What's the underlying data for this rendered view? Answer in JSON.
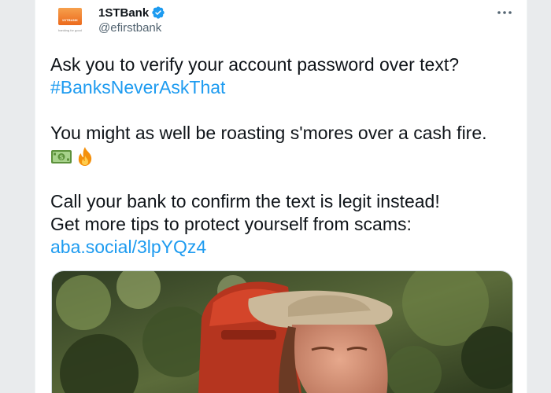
{
  "tweet": {
    "display_name": "1STBank",
    "handle": "@efirstbank",
    "more_icon": "more-horizontal-icon",
    "verified_icon": "verified-badge-icon",
    "avatar": {
      "logo_text": "1STBANK",
      "tagline": "banking for good"
    },
    "body": {
      "line1": "Ask you to verify your account password over text?",
      "hashtag": "#BanksNeverAskThat",
      "line2": "You might as well be roasting s'mores over a cash fire.",
      "emojis": [
        "dollar-banknote-icon",
        "fire-icon"
      ],
      "line3": "Call your bank to confirm the text is legit instead!",
      "line4": "Get more tips to protect yourself from scams:",
      "link": "aba.social/3lpYQz4"
    },
    "media": {
      "kind": "photo",
      "subject": "person-in-bucket-hat-with-backpack"
    }
  },
  "colors": {
    "link": "#1d9bf0",
    "text": "#0f1419",
    "secondary_text": "#536471",
    "brand_orange": "#ec6a1c",
    "verified": "#1d9bf0"
  }
}
